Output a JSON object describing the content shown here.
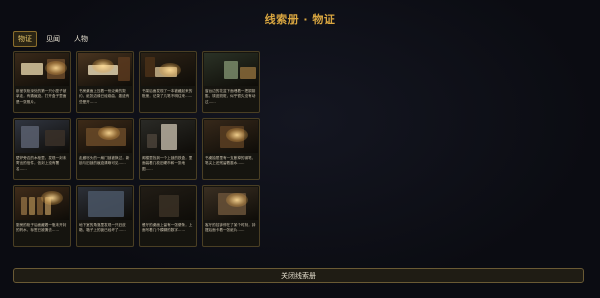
{
  "title": "线索册 · 物证",
  "tabs": [
    {
      "label": "物证",
      "active": true
    },
    {
      "label": "见闻",
      "active": false
    },
    {
      "label": "人物",
      "active": false
    }
  ],
  "cards": [
    {
      "desc": "卧室衣柜深处的第一只小匣子被拿走，有撬痕迹。打开盒子里面是一张照片。",
      "bg": "#3a2a1a",
      "glow": true
    },
    {
      "desc": "书房桌面上压着一份泛黄的契约，纸张边缘已经卷曲，墨迹有些晕开……",
      "bg": "#4a3520",
      "glow": true
    },
    {
      "desc": "书架后面发现了一本被藏起来的账册，记录了几笔不明往来……",
      "bg": "#2e2316",
      "glow": true
    },
    {
      "desc": "窗台边的花盆下面埋着一把铜钥匙，锈迹斑斑，似乎很久没有动过……",
      "bg": "#2b3226",
      "glow": false
    },
    {
      "desc": "壁炉旁边的木柜里，发现一封未寄出的信件，信封上没有署名……",
      "bg": "#303540",
      "glow": false
    },
    {
      "desc": "走廊尽头的一扇门锁被换过，新锁与旧锁的痕迹清晰可见……",
      "bg": "#3d2a18",
      "glow": true
    },
    {
      "desc": "阁楼里找到一个上锁的铁盒，里面装着几枚旧硬币和一张地图……",
      "bg": "#2a2a26",
      "glow": false
    },
    {
      "desc": "书桌抽屉里有一支断掉的钢笔，笔尖上还残留着墨水……",
      "bg": "#36281a",
      "glow": true
    },
    {
      "desc": "厨房的柜子后面藏着一瓶未开封的药水，标签已被撕去……",
      "bg": "#402c1a",
      "glow": true
    },
    {
      "desc": "地下室的角落里发现一只旧皮箱，箱子上的锁已经坏了……",
      "bg": "#2c3038",
      "glow": false
    },
    {
      "desc": "餐厅的桌面上留有一张便条，上面写着几个模糊的数字……",
      "bg": "#221d16",
      "glow": false
    },
    {
      "desc": "客厅的挂钟停在了某个时刻，钟摆后面卡着一张纸片……",
      "bg": "#3a2f22",
      "glow": true
    }
  ],
  "close_label": "关闭线索册"
}
